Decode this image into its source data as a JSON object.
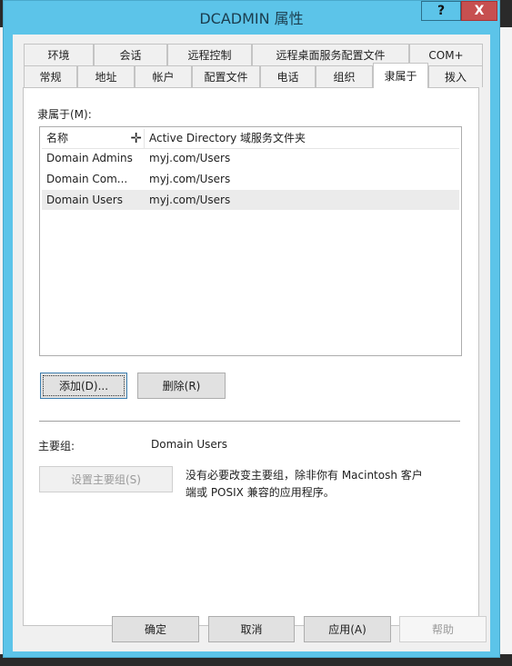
{
  "window": {
    "title": "DCADMIN 属性",
    "help_button": "?",
    "close_button": "X"
  },
  "tabs_row1": [
    "环境",
    "会话",
    "远程控制",
    "远程桌面服务配置文件",
    "COM+"
  ],
  "tabs_row2": [
    "常规",
    "地址",
    "帐户",
    "配置文件",
    "电话",
    "组织",
    "隶属于",
    "拨入"
  ],
  "selected_tab": "隶属于",
  "member_of": {
    "label": "隶属于(M):",
    "columns": [
      "名称",
      "Active Directory 域服务文件夹"
    ],
    "rows": [
      [
        "Domain Admins",
        "myj.com/Users"
      ],
      [
        "Domain Com...",
        "myj.com/Users"
      ],
      [
        "Domain Users",
        "myj.com/Users"
      ]
    ],
    "add_button": "添加(D)...",
    "remove_button": "删除(R)"
  },
  "primary_group": {
    "label": "主要组:",
    "value": "Domain Users",
    "set_button": "设置主要组(S)",
    "note_line1": "没有必要改变主要组，除非你有 Macintosh 客户",
    "note_line2": "端或 POSIX 兼容的应用程序。"
  },
  "footer": {
    "ok": "确定",
    "cancel": "取消",
    "apply": "应用(A)",
    "help": "帮助"
  }
}
